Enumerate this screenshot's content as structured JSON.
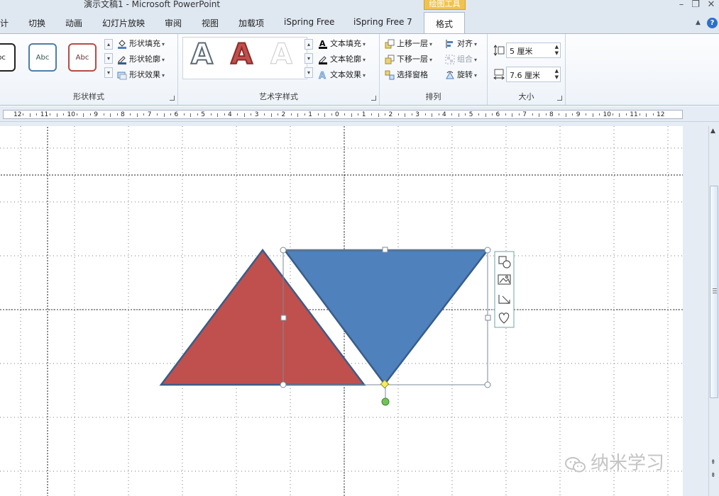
{
  "window": {
    "title": "演示文稿1 - Microsoft PowerPoint",
    "context_tab": "绘图工具"
  },
  "tabs": [
    {
      "label": "计"
    },
    {
      "label": "切换"
    },
    {
      "label": "动画"
    },
    {
      "label": "幻灯片放映"
    },
    {
      "label": "审阅"
    },
    {
      "label": "视图"
    },
    {
      "label": "加载项"
    },
    {
      "label": "iSpring Free"
    },
    {
      "label": "iSpring Free 7"
    },
    {
      "label": "格式"
    }
  ],
  "ribbon": {
    "shape_styles": {
      "label": "形状样式",
      "swatches": [
        "bc",
        "Abc",
        "Abc"
      ],
      "fill": "形状填充",
      "outline": "形状轮廓",
      "effects": "形状效果"
    },
    "wordart_styles": {
      "label": "艺术字样式",
      "letters": [
        "A",
        "A",
        "A"
      ],
      "text_fill": "文本填充",
      "text_outline": "文本轮廓",
      "text_effects": "文本效果"
    },
    "arrange": {
      "label": "排列",
      "bring_forward": "上移一层",
      "send_backward": "下移一层",
      "selection_pane": "选择窗格",
      "align": "对齐",
      "group": "组合",
      "rotate": "旋转"
    },
    "size": {
      "label": "大小",
      "height": "5 厘米",
      "width": "7.6 厘米"
    }
  },
  "ruler": {
    "labels": [
      "12",
      "11",
      "10",
      "9",
      "8",
      "7",
      "6",
      "5",
      "4",
      "3",
      "2",
      "1",
      "0",
      "1",
      "2",
      "3",
      "4",
      "5",
      "6",
      "7",
      "8",
      "9",
      "10",
      "11",
      "12"
    ]
  },
  "colors": {
    "red_triangle": "#c0504d",
    "blue_triangle": "#4f81bd",
    "outline": "#385d8a"
  },
  "layout_options_icons": [
    "shape-icon",
    "picture-icon",
    "resize-icon",
    "heart-icon"
  ],
  "watermark": "纳米学习"
}
